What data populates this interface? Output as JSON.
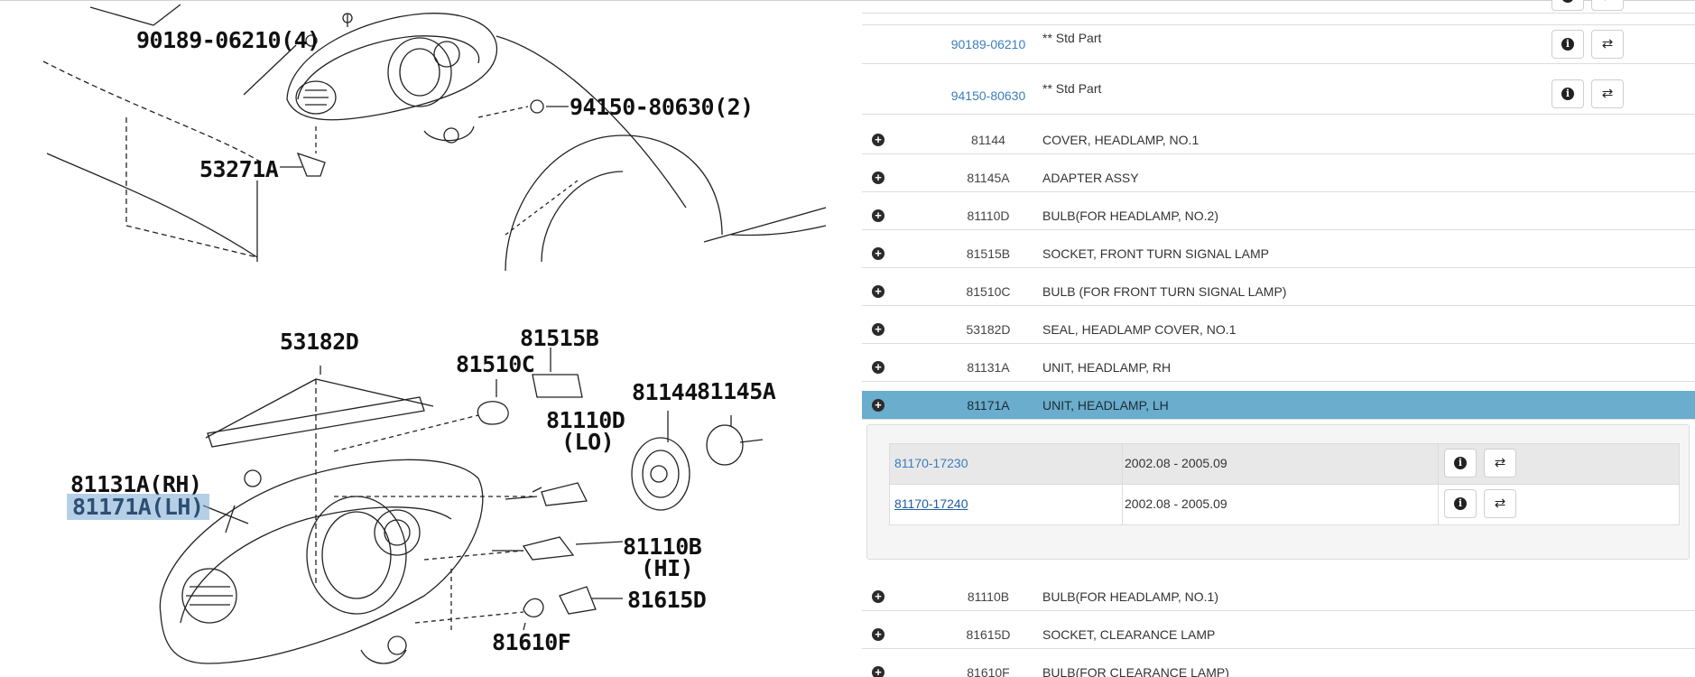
{
  "diagram": {
    "callouts": [
      "90189-06210(4)",
      "94150-80630(2)",
      "53271A",
      "53182D",
      "81515B",
      "81510C",
      "81144",
      "81145A",
      "81110D",
      "(LO)",
      "81131A(RH)",
      "81171A(LH)",
      "81110B",
      "(HI)",
      "81615D",
      "81610F"
    ]
  },
  "parts_list": {
    "top_partial_buttons": [
      "info-icon",
      "swap-icon"
    ],
    "std_rows": [
      {
        "number": "90189-06210",
        "name": "** Std Part"
      },
      {
        "number": "94150-80630",
        "name": "** Std Part"
      }
    ],
    "rows": [
      {
        "number": "81144",
        "name": "COVER, HEADLAMP, NO.1"
      },
      {
        "number": "81145A",
        "name": "ADAPTER ASSY"
      },
      {
        "number": "81110D",
        "name": "BULB(FOR HEADLAMP, NO.2)"
      },
      {
        "number": "81515B",
        "name": "SOCKET, FRONT TURN SIGNAL LAMP"
      },
      {
        "number": "81510C",
        "name": "BULB (FOR FRONT TURN SIGNAL LAMP)"
      },
      {
        "number": "53182D",
        "name": "SEAL, HEADLAMP COVER, NO.1"
      },
      {
        "number": "81131A",
        "name": "UNIT, HEADLAMP, RH"
      },
      {
        "number": "81171A",
        "name": "UNIT, HEADLAMP, LH"
      }
    ],
    "sub_rows": [
      {
        "number": "81170-17230",
        "date": "2002.08 - 2005.09"
      },
      {
        "number": "81170-17240",
        "date": "2002.08 - 2005.09"
      }
    ],
    "rows_after": [
      {
        "number": "81110B",
        "name": "BULB(FOR HEADLAMP, NO.1)"
      },
      {
        "number": "81615D",
        "name": "SOCKET, CLEARANCE LAMP"
      },
      {
        "number": "81610F",
        "name": "BULB(FOR CLEARANCE LAMP)"
      }
    ],
    "selected_color": "#6aadcd",
    "link_color": "#3a7dbd"
  }
}
